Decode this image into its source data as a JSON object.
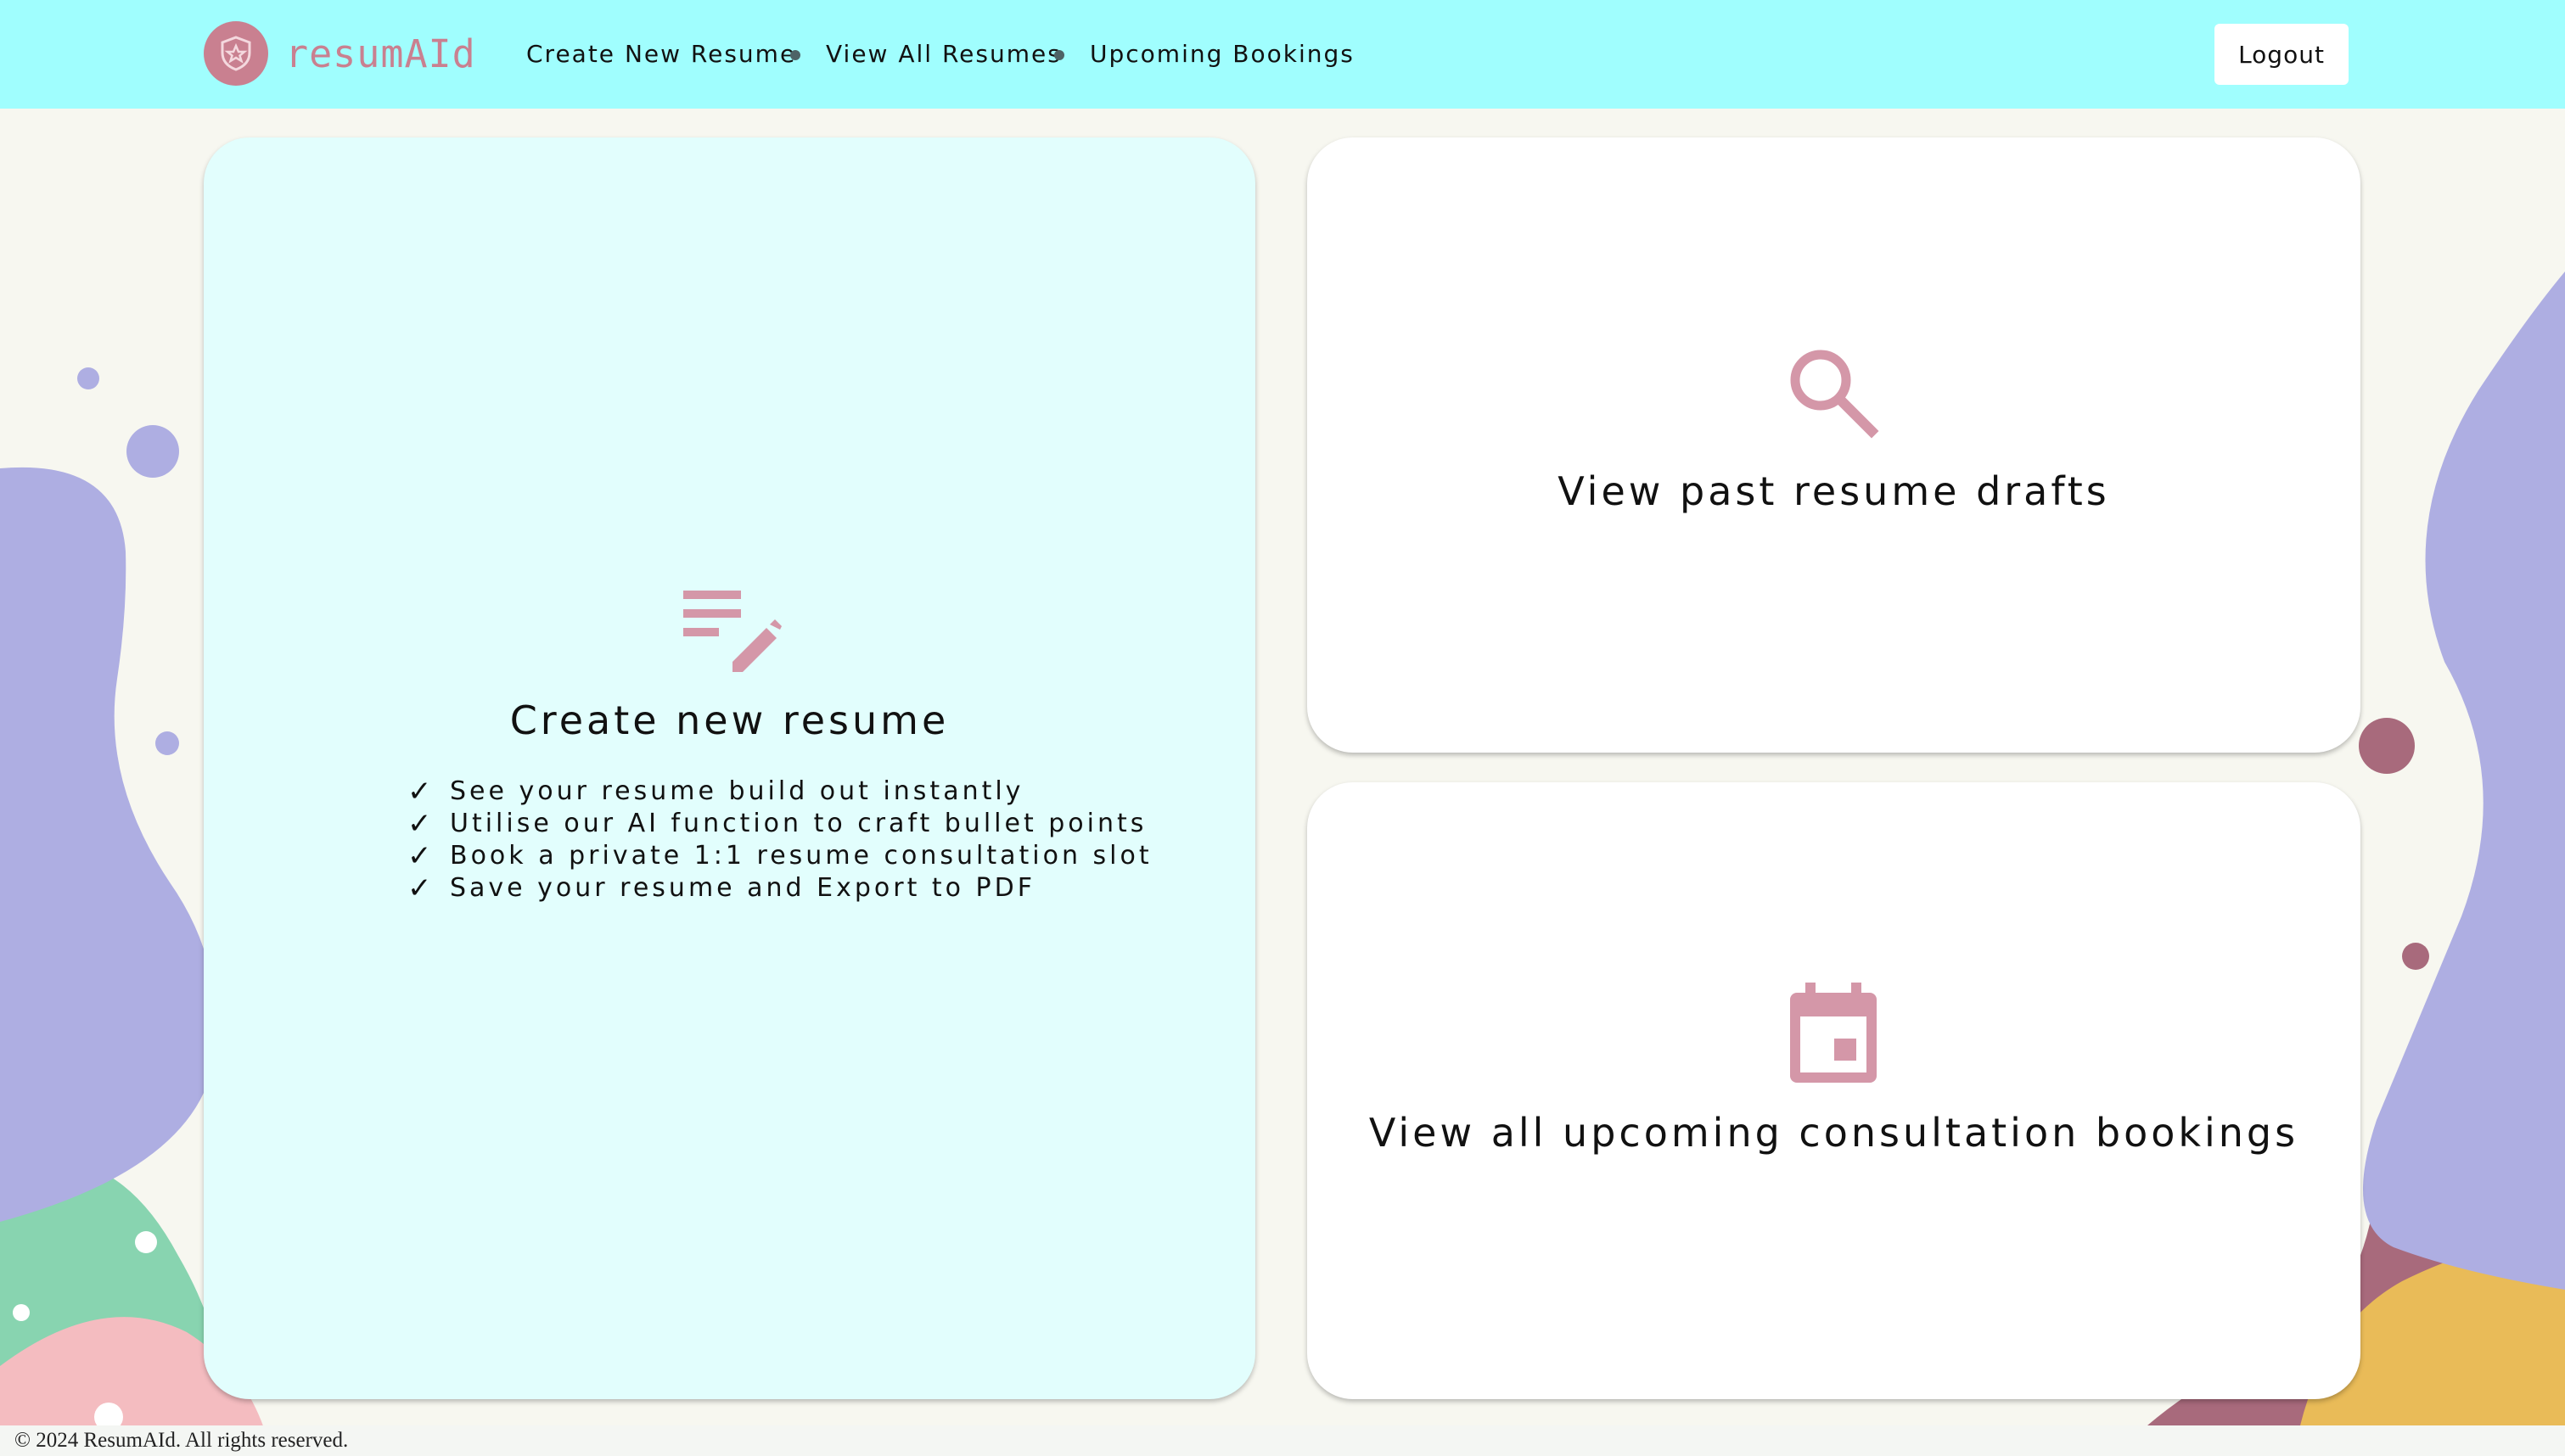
{
  "brand": {
    "name": "resumAId"
  },
  "nav": {
    "links": [
      "Create New Resume",
      "View All Resumes",
      "Upcoming Bookings"
    ],
    "logout_label": "Logout"
  },
  "cards": {
    "create": {
      "title": "Create new resume",
      "icon": "edit-list-icon",
      "features": [
        "See your resume build out instantly",
        "Utilise our AI function to craft bullet points",
        "Book a private 1:1 resume consultation slot",
        "Save your resume and Export to PDF"
      ],
      "check_mark": "✓"
    },
    "drafts": {
      "title": "View past resume drafts",
      "icon": "search-icon"
    },
    "bookings": {
      "title": "View all upcoming consultation bookings",
      "icon": "calendar-icon"
    }
  },
  "footer": {
    "text": "© 2024 ResumAId. All rights reserved."
  },
  "colors": {
    "navbar": "#a0fefe",
    "accent": "#c98090",
    "background": "#f7f7f0",
    "create_card": "#e2fefd",
    "blob_purple": "#aeaee2",
    "blob_maroon": "#a86a7c",
    "blob_green": "#88d4b0",
    "blob_pink": "#f4bcc0",
    "blob_yellow": "#e9bb58"
  }
}
